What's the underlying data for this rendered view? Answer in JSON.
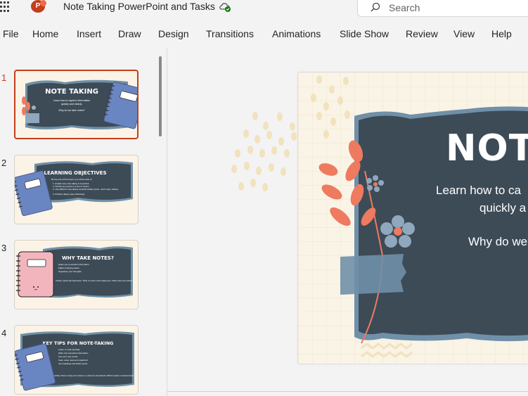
{
  "app": {
    "doc_title": "Note Taking PowerPoint and Tasks",
    "search_placeholder": "Search",
    "logo_letter": "P"
  },
  "menu": [
    "File",
    "Home",
    "Insert",
    "Draw",
    "Design",
    "Transitions",
    "Animations",
    "Slide Show",
    "Review",
    "View",
    "Help"
  ],
  "thumbnails": [
    {
      "number": "1",
      "title": "NOTE TAKING",
      "lines": [
        "Learn how to capture information",
        "quickly and clearly.",
        "Why do we take notes?"
      ],
      "selected": true
    },
    {
      "number": "2",
      "title": "LEARNING OBJECTIVES",
      "lines": [
        "By the end of this lesson you will be able to:",
        "1. Explain why note-taking is important.",
        "2. Identify key points in a text or lesson.",
        "3. Use different note-taking methods (bullet points, mind maps, tables).",
        "4. Practice taking notes effectively."
      ],
      "selected": false
    },
    {
      "number": "3",
      "title": "WHY TAKE NOTES?",
      "lines": [
        "Helps you remember information.",
        "Makes studying easier.",
        "Organizes your thoughts.",
        "Activity: Quick pair discussion: Think of a time notes helped you. Share with your partner."
      ],
      "selected": false
    },
    {
      "number": "4",
      "title": "KEY TIPS FOR NOTE-TAKING",
      "lines": [
        "Listen or read carefully.",
        "Write only important information.",
        "Use your own words.",
        "Keep notes neat and organized.",
        "Use headings and bullet points.",
        "Activity: Show a messy set of notes vs. a clear set. Ask students: Which is easier to read and why?"
      ],
      "selected": false
    }
  ],
  "slide": {
    "title": "NOTE",
    "subtitle_line1": "Learn how to ca",
    "subtitle_line2": "quickly a",
    "subtitle_line3": "Why do we"
  },
  "colors": {
    "accent": "#c43e1c",
    "slide_dark": "#3d4b57",
    "slide_blue_border": "#6f90a8",
    "leaf": "#ee7a5f",
    "cream": "#faf4e6",
    "notebook_blue": "#6a86c2",
    "notebook_pink": "#f3b5bd"
  }
}
